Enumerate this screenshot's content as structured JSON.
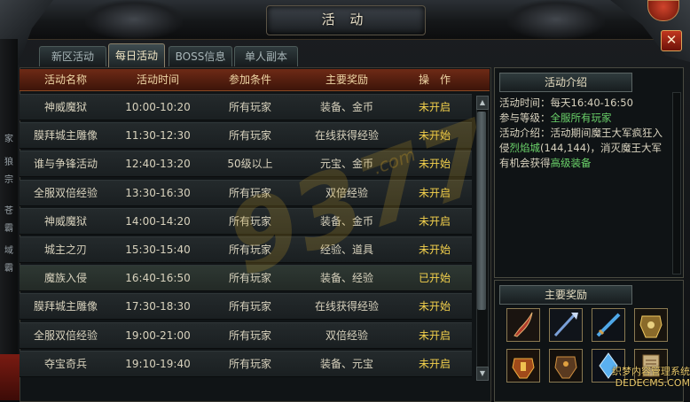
{
  "window": {
    "title": "活 动",
    "close_label": "✕"
  },
  "tabs": [
    {
      "label": "新区活动",
      "active": false
    },
    {
      "label": "每日活动",
      "active": true
    },
    {
      "label": "BOSS信息",
      "active": false
    },
    {
      "label": "单人副本",
      "active": false
    }
  ],
  "table": {
    "headers": [
      "活动名称",
      "活动时间",
      "参加条件",
      "主要奖励",
      "操　作"
    ],
    "rows": [
      {
        "name": "神威魔狱",
        "time": "10:00-10:20",
        "condition": "所有玩家",
        "reward": "装备、金币",
        "status": "未开启"
      },
      {
        "name": "膜拜城主雕像",
        "time": "11:30-12:30",
        "condition": "所有玩家",
        "reward": "在线获得经验",
        "status": "未开始"
      },
      {
        "name": "谁与争锋活动",
        "time": "12:40-13:20",
        "condition": "50级以上",
        "reward": "元宝、金币",
        "status": "未开始"
      },
      {
        "name": "全服双倍经验",
        "time": "13:30-16:30",
        "condition": "所有玩家",
        "reward": "双倍经验",
        "status": "未开启"
      },
      {
        "name": "神威魔狱",
        "time": "14:00-14:20",
        "condition": "所有玩家",
        "reward": "装备、金币",
        "status": "未开启"
      },
      {
        "name": "城主之刃",
        "time": "15:30-15:40",
        "condition": "所有玩家",
        "reward": "经验、道具",
        "status": "未开始"
      },
      {
        "name": "魔族入侵",
        "time": "16:40-16:50",
        "condition": "所有玩家",
        "reward": "装备、经验",
        "status": "已开始"
      },
      {
        "name": "膜拜城主雕像",
        "time": "17:30-18:30",
        "condition": "所有玩家",
        "reward": "在线获得经验",
        "status": "未开始"
      },
      {
        "name": "全服双倍经验",
        "time": "19:00-21:00",
        "condition": "所有玩家",
        "reward": "双倍经验",
        "status": "未开启"
      },
      {
        "name": "夺宝奇兵",
        "time": "19:10-19:40",
        "condition": "所有玩家",
        "reward": "装备、元宝",
        "status": "未开启"
      }
    ]
  },
  "intro": {
    "header": "活动介绍",
    "time_label": "活动时间：",
    "time_value": "每天16:40-16:50",
    "level_label": "参与等级：",
    "level_value": "全服所有玩家",
    "desc_label": "活动介绍：",
    "desc_1": "活动期间魔王大军疯狂入侵",
    "desc_place": "烈焰城",
    "desc_coords": "(144,144)",
    "desc_2": "，消灭魔王大军有机会获得",
    "desc_reward": "高级装备"
  },
  "rewards": {
    "header": "主要奖励",
    "items": [
      "curved-blade-icon",
      "spear-icon",
      "blue-sword-icon",
      "golden-armor-icon",
      "warrior-armor-icon",
      "dark-armor-icon",
      "crystal-icon",
      "scroll-book-icon"
    ]
  },
  "watermark": {
    "text": "9377",
    "suffix": ".com"
  },
  "corner_mark": {
    "line1": "织梦内容管理系统",
    "line2": "DEDECMS.COM"
  },
  "side_glyphs": [
    "家",
    "狼",
    "宗",
    "苍",
    "霸",
    "域",
    "霸"
  ]
}
